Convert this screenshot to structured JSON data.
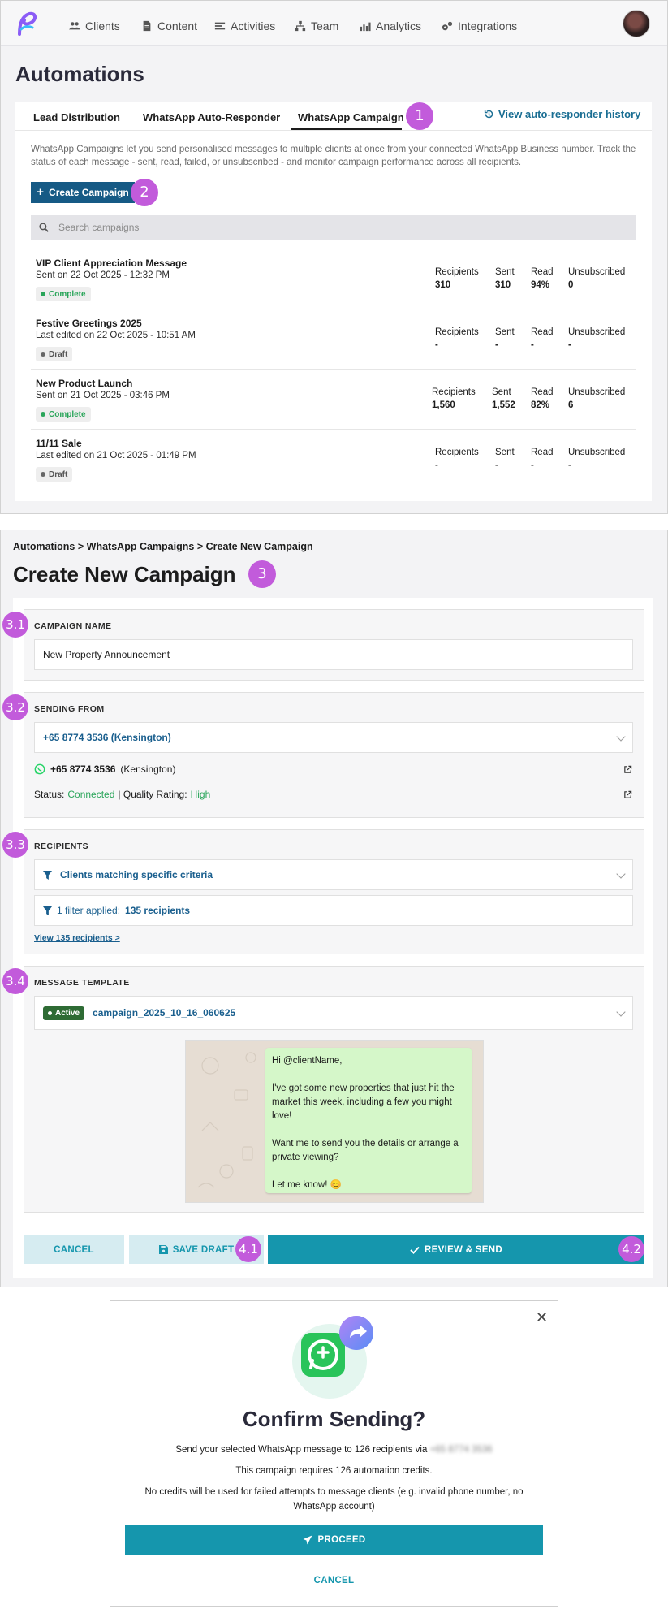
{
  "nav": {
    "items": [
      "Clients",
      "Content",
      "Activities",
      "Team",
      "Analytics",
      "Integrations"
    ]
  },
  "automations": {
    "title": "Automations",
    "tabs": [
      "Lead Distribution",
      "WhatsApp Auto-Responder",
      "WhatsApp Campaign"
    ],
    "active_tab": "WhatsApp Campaign",
    "history_link": "View auto-responder history",
    "description": "WhatsApp Campaigns let you send personalised messages to multiple clients at once from your connected WhatsApp Business number. Track the status of each message - sent, read, failed, or unsubscribed - and monitor campaign performance across all recipients.",
    "create_button": "Create Campaign",
    "search_placeholder": "Search campaigns",
    "stat_labels": {
      "recipients": "Recipients",
      "sent": "Sent",
      "read": "Read",
      "unsubscribed": "Unsubscribed"
    },
    "campaigns": [
      {
        "name": "VIP Client Appreciation Message",
        "sub": "Sent on 22 Oct 2025 - 12:32 PM",
        "status": "Complete",
        "recipients": "310",
        "sent": "310",
        "read": "94%",
        "unsubscribed": "0"
      },
      {
        "name": "Festive Greetings 2025",
        "sub": "Last edited on 22 Oct 2025 - 10:51 AM",
        "status": "Draft",
        "recipients": "-",
        "sent": "-",
        "read": "-",
        "unsubscribed": "-"
      },
      {
        "name": "New Product Launch",
        "sub": "Sent on 21 Oct 2025 - 03:46 PM",
        "status": "Complete",
        "recipients": "1,560",
        "sent": "1,552",
        "read": "82%",
        "unsubscribed": "6"
      },
      {
        "name": "11/11 Sale",
        "sub": "Last edited on 21 Oct 2025 - 01:49 PM",
        "status": "Draft",
        "recipients": "-",
        "sent": "-",
        "read": "-",
        "unsubscribed": "-"
      }
    ]
  },
  "badges": {
    "b1": "1",
    "b2": "2",
    "b3": "3",
    "b31": "3.1",
    "b32": "3.2",
    "b33": "3.3",
    "b34": "3.4",
    "b41": "4.1",
    "b42": "4.2"
  },
  "create": {
    "breadcrumb": {
      "a": "Automations",
      "b": "WhatsApp Campaigns",
      "c": "Create New Campaign",
      "sep": ">"
    },
    "title": "Create New Campaign",
    "campaign_name_label": "CAMPAIGN NAME",
    "campaign_name_value": "New Property Announcement",
    "sending_from_label": "SENDING FROM",
    "sending_from_value": "+65 8774 3536 (Kensington)",
    "number_bold": "+65 8774 3536",
    "number_suffix": "(Kensington)",
    "status_label": "Status:",
    "status_value": "Connected",
    "quality_label": "| Quality Rating:",
    "quality_value": "High",
    "recipients_label": "RECIPIENTS",
    "recipients_value": "Clients matching specific criteria",
    "filter_text": "1 filter applied:",
    "filter_count": "135 recipients",
    "view_link": "View 135 recipients >",
    "template_label": "MESSAGE TEMPLATE",
    "template_status": "Active",
    "template_name": "campaign_2025_10_16_060625",
    "message": {
      "p1": "Hi @clientName,",
      "p2": "I've got some new properties that just hit the market this week, including a few you might love!",
      "p3": "Want me to send you the details or arrange a private viewing?",
      "p4": "Let me know! 😊"
    },
    "cancel": "CANCEL",
    "save_draft": "SAVE DRAFT",
    "review_send": "REVIEW & SEND"
  },
  "modal": {
    "title": "Confirm Sending?",
    "line1": "Send your selected WhatsApp message to 126 recipients via",
    "line1_blurred": "+65 8774 3536",
    "line2": "This campaign requires 126 automation credits.",
    "line3": "No credits will be used for failed attempts to message clients (e.g. invalid phone number, no WhatsApp account)",
    "proceed": "PROCEED",
    "cancel": "CANCEL"
  },
  "colors": {
    "accent": "#1596ad",
    "badge": "#c25bdb",
    "primary_button": "#165a85",
    "success": "#2aa55a",
    "link": "#1a6e93"
  }
}
